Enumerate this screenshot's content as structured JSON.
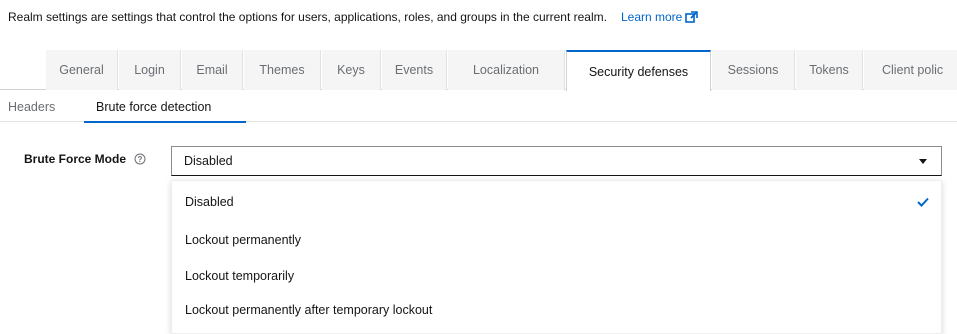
{
  "description": {
    "text": "Realm settings are settings that control the options for users, applications, roles, and groups in the current realm.",
    "learn_more": "Learn more",
    "learn_more_icon": "external-link-icon"
  },
  "tabs": [
    {
      "label": "General"
    },
    {
      "label": "Login"
    },
    {
      "label": "Email"
    },
    {
      "label": "Themes"
    },
    {
      "label": "Keys"
    },
    {
      "label": "Events"
    },
    {
      "label": "Localization"
    },
    {
      "label": "Security defenses",
      "active": true
    },
    {
      "label": "Sessions"
    },
    {
      "label": "Tokens"
    },
    {
      "label": "Client polic"
    }
  ],
  "subtabs": [
    {
      "label": "Headers"
    },
    {
      "label": "Brute force detection",
      "active": true
    }
  ],
  "form": {
    "label": "Brute Force Mode",
    "help_icon": "help-circle-icon",
    "selected_value": "Disabled",
    "options": [
      {
        "label": "Disabled",
        "selected": true
      },
      {
        "label": "Lockout permanently"
      },
      {
        "label": "Lockout temporarily"
      },
      {
        "label": "Lockout permanently after temporary lockout"
      }
    ]
  },
  "colors": {
    "accent": "#0066cc",
    "text": "#151515",
    "muted": "#6a6e73"
  }
}
